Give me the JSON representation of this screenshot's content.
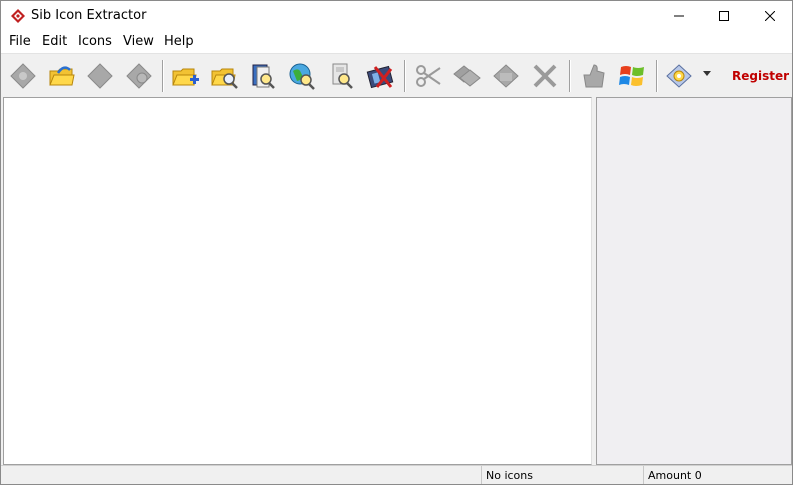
{
  "window": {
    "title": "Sib Icon Extractor",
    "controls": {
      "minimize": "minimize",
      "maximize": "maximize",
      "close": "close"
    }
  },
  "menu": [
    "File",
    "Edit",
    "Icons",
    "View",
    "Help"
  ],
  "toolbar": {
    "groups": [
      [
        "save-icons-icon",
        "open-folder-icon",
        "copy-icon",
        "paste-icon"
      ],
      [
        "add-folder-icon",
        "search-folder-icon",
        "find-files-icon",
        "search-web-icon",
        "extract-icon",
        "filmstrip-icon"
      ],
      [
        "cut-icon",
        "copy-icon",
        "paste-icon",
        "delete-icon"
      ],
      [
        "thumb-up-icon",
        "windows-logo-icon"
      ],
      [
        "options-icon"
      ]
    ],
    "register_label": "Register"
  },
  "status": {
    "cell1": "",
    "cell2": "No icons",
    "cell3": "Amount 0"
  },
  "colors": {
    "register": "#c00000",
    "side_pane": "#f0eff2"
  }
}
